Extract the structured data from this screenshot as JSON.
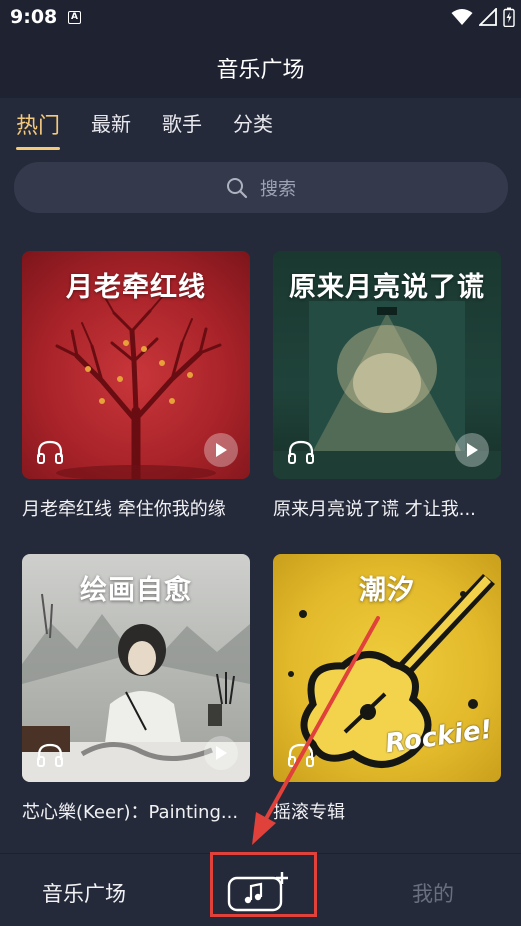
{
  "status_bar": {
    "time": "9:08",
    "notification_icon_letter": "A"
  },
  "header": {
    "title": "音乐广场"
  },
  "tabs": [
    {
      "label": "热门",
      "active": true
    },
    {
      "label": "最新",
      "active": false
    },
    {
      "label": "歌手",
      "active": false
    },
    {
      "label": "分类",
      "active": false
    }
  ],
  "search": {
    "placeholder": "搜索"
  },
  "cards": [
    {
      "cover_title": "月老牵红线",
      "label": "月老牵红线 牵住你我的缘",
      "theme": "red-tree"
    },
    {
      "cover_title": "原来月亮说了谎",
      "label": "原来月亮说了谎 才让我...",
      "theme": "green-stage"
    },
    {
      "cover_title": "绘画自愈",
      "label": "芯心樂(Keer)：Painting...",
      "theme": "ink-painting"
    },
    {
      "cover_title": "潮汐",
      "label": "摇滚专辑",
      "theme": "yellow-guitar",
      "watermark": "Rockie!"
    }
  ],
  "bottom_nav": {
    "left": "音乐广场",
    "center_icon": "music-add-icon",
    "right": "我的"
  },
  "colors": {
    "accent": "#f4c97a",
    "background": "#252a3a",
    "annotation": "#e0413a"
  }
}
